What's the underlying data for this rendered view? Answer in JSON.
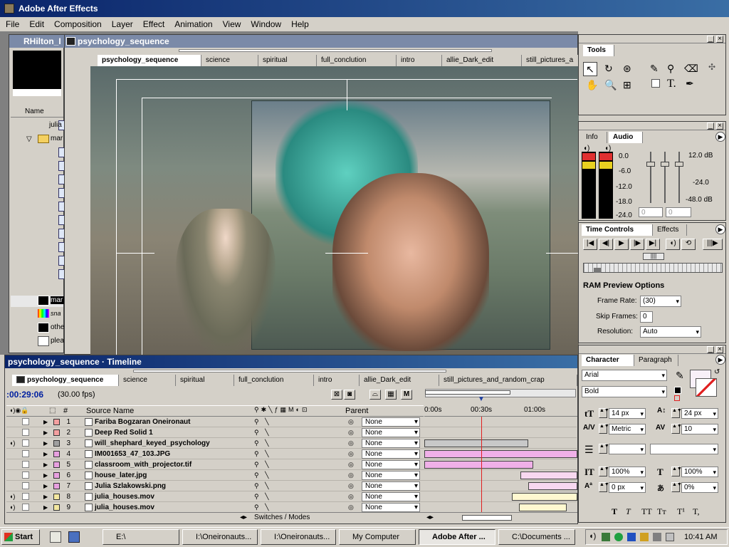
{
  "app": {
    "title": "Adobe After Effects"
  },
  "menu": [
    "File",
    "Edit",
    "Composition",
    "Layer",
    "Effect",
    "Animation",
    "View",
    "Window",
    "Help"
  ],
  "project": {
    "title": "RHilton_I",
    "column": "Name",
    "items": [
      "julia",
      "mar",
      "",
      "",
      "",
      "",
      "",
      "",
      "",
      "",
      "",
      "",
      "mar",
      "sna",
      "othe",
      "plea"
    ]
  },
  "comp": {
    "title": "psychology_sequence",
    "tabs": [
      "psychology_sequence",
      "science",
      "spiritual",
      "full_conclution",
      "intro",
      "allie_Dark_edit",
      "still_pictures_a"
    ]
  },
  "tools": {
    "title": "Tools"
  },
  "audio": {
    "tabs": [
      "Info",
      "Audio"
    ],
    "levels": [
      "0.0",
      "-6.0",
      "-12.0",
      "-18.0",
      "-24.0"
    ],
    "db": [
      "12.0 dB",
      "-24.0",
      "-48.0 dB"
    ],
    "fields": [
      "0",
      "0"
    ]
  },
  "time_controls": {
    "tabs": [
      "Time Controls",
      "Effects"
    ],
    "ram_title": "RAM Preview Options",
    "frame_rate_label": "Frame Rate:",
    "frame_rate": "(30)",
    "skip_label": "Skip Frames:",
    "skip": "0",
    "res_label": "Resolution:",
    "res": "Auto"
  },
  "character": {
    "tabs": [
      "Character",
      "Paragraph"
    ],
    "font": "Arial",
    "style": "Bold",
    "size": "14 px",
    "leading": "24 px",
    "kerning": "Metric",
    "tracking": "10",
    "vscale": "100%",
    "hscale": "100%",
    "baseline": "0 px",
    "tsume": "0%",
    "format_buttons": [
      "T",
      "T",
      "TT",
      "Tт",
      "T¹",
      "T,"
    ]
  },
  "timeline": {
    "title": "psychology_sequence · Timeline",
    "tabs": [
      "psychology_sequence",
      "science",
      "spiritual",
      "full_conclution",
      "intro",
      "allie_Dark_edit",
      "still_pictures_and_random_crap"
    ],
    "timecode": ":00:29:06",
    "fps": "(30.00 fps)",
    "col_num": "#",
    "col_source": "Source Name",
    "col_parent": "Parent",
    "ruler": [
      "0:00s",
      "00:30s",
      "01:00s"
    ],
    "switches": "Switches / Modes",
    "layers": [
      {
        "num": "1",
        "name": "Fariba Bogzaran Oneironaut",
        "color": "#f4a0a0",
        "parent": "None",
        "bar": [
          0,
          0
        ],
        "barcolor": "none"
      },
      {
        "num": "2",
        "name": "Deep Red Solid 1",
        "color": "#f4a0a0",
        "parent": "None",
        "bar": [
          0,
          0
        ],
        "barcolor": "none"
      },
      {
        "num": "3",
        "name": "will_shephard_keyed_psychology",
        "color": "#a0a0a0",
        "parent": "None",
        "bar": [
          0,
          0.68
        ],
        "barcolor": "#c8c8c8"
      },
      {
        "num": "4",
        "name": "IM001653_47_103.JPG",
        "color": "#e8a0e0",
        "parent": "None",
        "bar": [
          0,
          1
        ],
        "barcolor": "#f0b0e8"
      },
      {
        "num": "5",
        "name": "classroom_with_projector.tif",
        "color": "#e8a0e0",
        "parent": "None",
        "bar": [
          0,
          0.71
        ],
        "barcolor": "#f0b0e8"
      },
      {
        "num": "6",
        "name": "house_later.jpg",
        "color": "#e8a0e0",
        "parent": "None",
        "bar": [
          0.63,
          1
        ],
        "barcolor": "#f8d8f0"
      },
      {
        "num": "7",
        "name": "Julia Szlakowski.png",
        "color": "#e8a0e0",
        "parent": "None",
        "bar": [
          0.68,
          1
        ],
        "barcolor": "#f8d8f0"
      },
      {
        "num": "8",
        "name": "julia_houses.mov",
        "color": "#f4e8a0",
        "parent": "None",
        "bar": [
          0.57,
          1
        ],
        "barcolor": "#fff8d0"
      },
      {
        "num": "9",
        "name": "julia_houses.mov",
        "color": "#f4e8a0",
        "parent": "None",
        "bar": [
          0.62,
          0.93
        ],
        "barcolor": "#fff8d0"
      }
    ]
  },
  "taskbar": {
    "start": "Start",
    "items": [
      "E:\\",
      "I:\\Oneironauts...",
      "I:\\Oneironauts...",
      "My Computer",
      "Adobe After ...",
      "C:\\Documents ..."
    ],
    "time": "10:41 AM"
  }
}
